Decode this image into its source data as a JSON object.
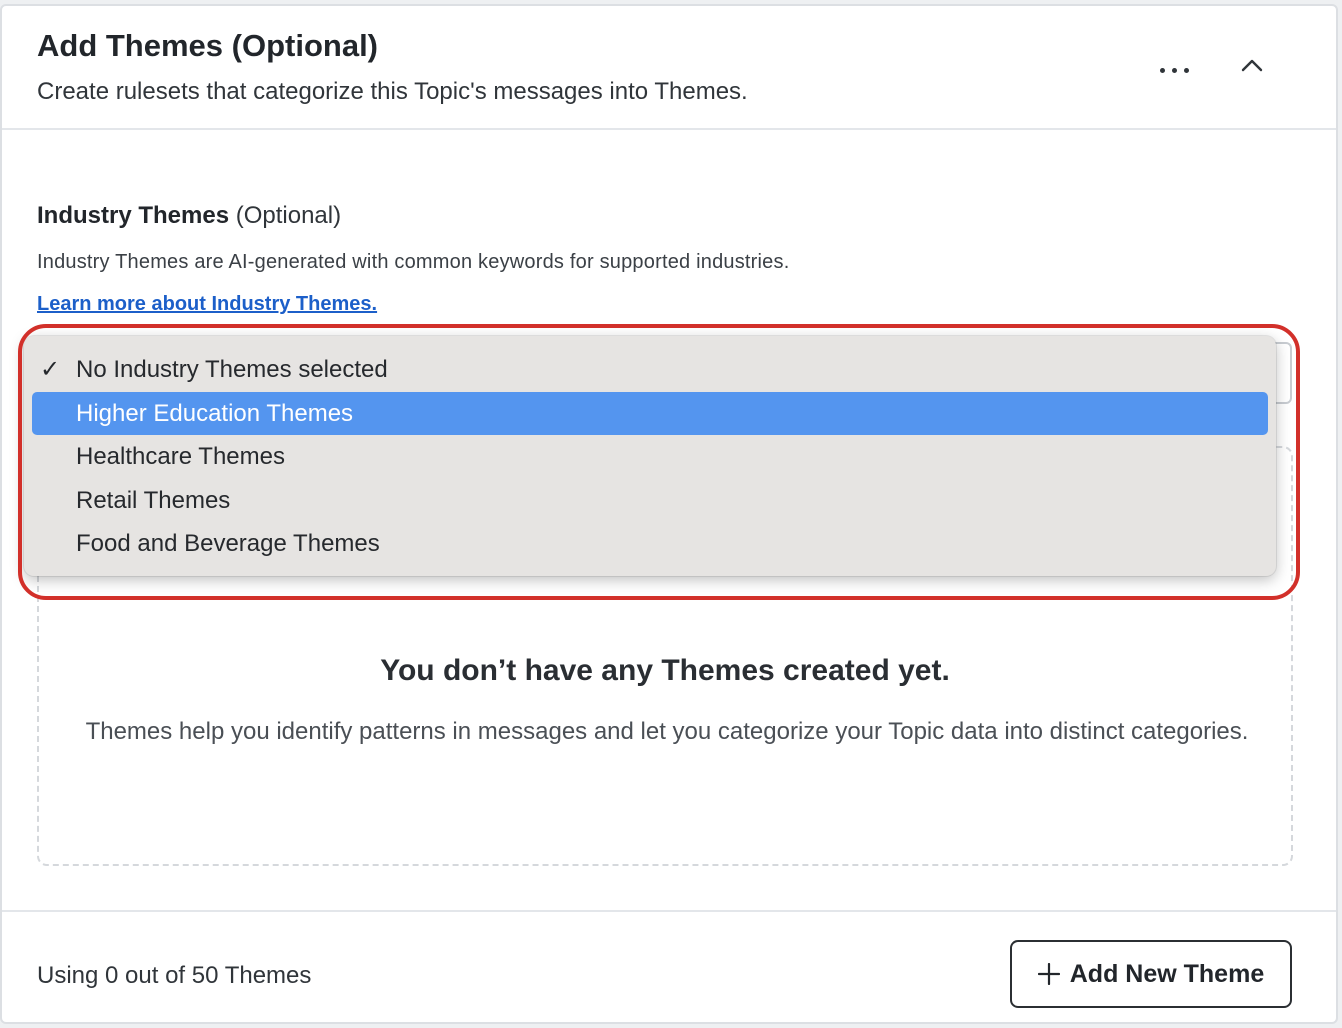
{
  "header": {
    "title": "Add Themes (Optional)",
    "subtitle": "Create rulesets that categorize this Topic's messages into Themes."
  },
  "industry": {
    "label": "Industry Themes",
    "optional": "(Optional)",
    "description": "Industry Themes are AI-generated with common keywords for supported industries.",
    "learn_more": "Learn more about Industry Themes."
  },
  "dropdown": {
    "checkmark": "✓",
    "items": [
      {
        "label": "No Industry Themes selected",
        "selected": true,
        "highlighted": false
      },
      {
        "label": "Higher Education Themes",
        "selected": false,
        "highlighted": true
      },
      {
        "label": "Healthcare Themes",
        "selected": false,
        "highlighted": false
      },
      {
        "label": "Retail Themes",
        "selected": false,
        "highlighted": false
      },
      {
        "label": "Food and Beverage Themes",
        "selected": false,
        "highlighted": false
      }
    ]
  },
  "empty_state": {
    "title": "You don’t have any Themes created yet.",
    "description": "Themes help you identify patterns in messages and let you categorize your Topic data into distinct categories."
  },
  "footer": {
    "usage": "Using 0 out of 50 Themes",
    "add_button": "Add New Theme"
  },
  "icons": {
    "more": "more-horizontal-icon",
    "collapse": "chevron-up-icon",
    "check": "checkmark-icon",
    "add": "plus-icon"
  },
  "colors": {
    "link": "#1c5fc9",
    "highlight": "#5495ef",
    "focus_ring": "#d2302a",
    "dropdown_bg": "#e6e4e2"
  }
}
